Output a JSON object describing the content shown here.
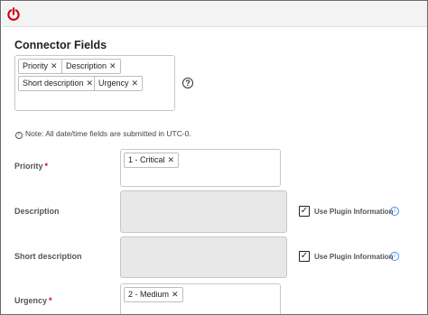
{
  "header": {
    "power_icon": "power-icon",
    "accent": "#d0021b"
  },
  "connector": {
    "title": "Connector Fields",
    "chips": [
      {
        "label": "Priority"
      },
      {
        "label": "Description"
      },
      {
        "label": "Short description"
      },
      {
        "label": "Urgency"
      }
    ],
    "remove_glyph": "✕",
    "help_glyph": "?"
  },
  "note": {
    "text": "Note: All date/time fields are submitted in UTC-0.",
    "icon_glyph": "!"
  },
  "fields": {
    "priority": {
      "label": "Priority",
      "required": "*",
      "value": "1 - Critical"
    },
    "description": {
      "label": "Description",
      "checkbox_label": "Use Plugin Information",
      "checked": true
    },
    "short_description": {
      "label": "Short description",
      "checkbox_label": "Use Plugin Information",
      "checked": true
    },
    "urgency": {
      "label": "Urgency",
      "required": "*",
      "value": "2 - Medium"
    }
  },
  "check_glyph": "✓",
  "info_glyph": "i"
}
